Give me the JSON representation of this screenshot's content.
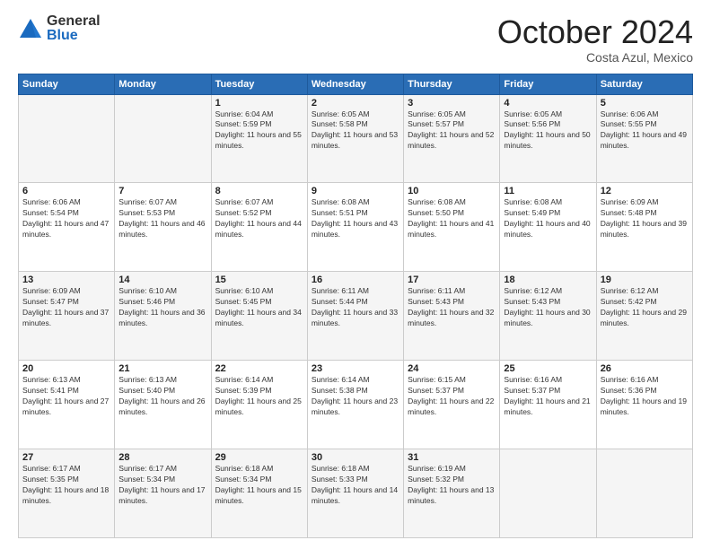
{
  "logo": {
    "general": "General",
    "blue": "Blue"
  },
  "title": {
    "month_year": "October 2024",
    "location": "Costa Azul, Mexico"
  },
  "weekdays": [
    "Sunday",
    "Monday",
    "Tuesday",
    "Wednesday",
    "Thursday",
    "Friday",
    "Saturday"
  ],
  "weeks": [
    [
      {
        "day": "",
        "info": ""
      },
      {
        "day": "",
        "info": ""
      },
      {
        "day": "1",
        "sunrise": "Sunrise: 6:04 AM",
        "sunset": "Sunset: 5:59 PM",
        "daylight": "Daylight: 11 hours and 55 minutes."
      },
      {
        "day": "2",
        "sunrise": "Sunrise: 6:05 AM",
        "sunset": "Sunset: 5:58 PM",
        "daylight": "Daylight: 11 hours and 53 minutes."
      },
      {
        "day": "3",
        "sunrise": "Sunrise: 6:05 AM",
        "sunset": "Sunset: 5:57 PM",
        "daylight": "Daylight: 11 hours and 52 minutes."
      },
      {
        "day": "4",
        "sunrise": "Sunrise: 6:05 AM",
        "sunset": "Sunset: 5:56 PM",
        "daylight": "Daylight: 11 hours and 50 minutes."
      },
      {
        "day": "5",
        "sunrise": "Sunrise: 6:06 AM",
        "sunset": "Sunset: 5:55 PM",
        "daylight": "Daylight: 11 hours and 49 minutes."
      }
    ],
    [
      {
        "day": "6",
        "sunrise": "Sunrise: 6:06 AM",
        "sunset": "Sunset: 5:54 PM",
        "daylight": "Daylight: 11 hours and 47 minutes."
      },
      {
        "day": "7",
        "sunrise": "Sunrise: 6:07 AM",
        "sunset": "Sunset: 5:53 PM",
        "daylight": "Daylight: 11 hours and 46 minutes."
      },
      {
        "day": "8",
        "sunrise": "Sunrise: 6:07 AM",
        "sunset": "Sunset: 5:52 PM",
        "daylight": "Daylight: 11 hours and 44 minutes."
      },
      {
        "day": "9",
        "sunrise": "Sunrise: 6:08 AM",
        "sunset": "Sunset: 5:51 PM",
        "daylight": "Daylight: 11 hours and 43 minutes."
      },
      {
        "day": "10",
        "sunrise": "Sunrise: 6:08 AM",
        "sunset": "Sunset: 5:50 PM",
        "daylight": "Daylight: 11 hours and 41 minutes."
      },
      {
        "day": "11",
        "sunrise": "Sunrise: 6:08 AM",
        "sunset": "Sunset: 5:49 PM",
        "daylight": "Daylight: 11 hours and 40 minutes."
      },
      {
        "day": "12",
        "sunrise": "Sunrise: 6:09 AM",
        "sunset": "Sunset: 5:48 PM",
        "daylight": "Daylight: 11 hours and 39 minutes."
      }
    ],
    [
      {
        "day": "13",
        "sunrise": "Sunrise: 6:09 AM",
        "sunset": "Sunset: 5:47 PM",
        "daylight": "Daylight: 11 hours and 37 minutes."
      },
      {
        "day": "14",
        "sunrise": "Sunrise: 6:10 AM",
        "sunset": "Sunset: 5:46 PM",
        "daylight": "Daylight: 11 hours and 36 minutes."
      },
      {
        "day": "15",
        "sunrise": "Sunrise: 6:10 AM",
        "sunset": "Sunset: 5:45 PM",
        "daylight": "Daylight: 11 hours and 34 minutes."
      },
      {
        "day": "16",
        "sunrise": "Sunrise: 6:11 AM",
        "sunset": "Sunset: 5:44 PM",
        "daylight": "Daylight: 11 hours and 33 minutes."
      },
      {
        "day": "17",
        "sunrise": "Sunrise: 6:11 AM",
        "sunset": "Sunset: 5:43 PM",
        "daylight": "Daylight: 11 hours and 32 minutes."
      },
      {
        "day": "18",
        "sunrise": "Sunrise: 6:12 AM",
        "sunset": "Sunset: 5:43 PM",
        "daylight": "Daylight: 11 hours and 30 minutes."
      },
      {
        "day": "19",
        "sunrise": "Sunrise: 6:12 AM",
        "sunset": "Sunset: 5:42 PM",
        "daylight": "Daylight: 11 hours and 29 minutes."
      }
    ],
    [
      {
        "day": "20",
        "sunrise": "Sunrise: 6:13 AM",
        "sunset": "Sunset: 5:41 PM",
        "daylight": "Daylight: 11 hours and 27 minutes."
      },
      {
        "day": "21",
        "sunrise": "Sunrise: 6:13 AM",
        "sunset": "Sunset: 5:40 PM",
        "daylight": "Daylight: 11 hours and 26 minutes."
      },
      {
        "day": "22",
        "sunrise": "Sunrise: 6:14 AM",
        "sunset": "Sunset: 5:39 PM",
        "daylight": "Daylight: 11 hours and 25 minutes."
      },
      {
        "day": "23",
        "sunrise": "Sunrise: 6:14 AM",
        "sunset": "Sunset: 5:38 PM",
        "daylight": "Daylight: 11 hours and 23 minutes."
      },
      {
        "day": "24",
        "sunrise": "Sunrise: 6:15 AM",
        "sunset": "Sunset: 5:37 PM",
        "daylight": "Daylight: 11 hours and 22 minutes."
      },
      {
        "day": "25",
        "sunrise": "Sunrise: 6:16 AM",
        "sunset": "Sunset: 5:37 PM",
        "daylight": "Daylight: 11 hours and 21 minutes."
      },
      {
        "day": "26",
        "sunrise": "Sunrise: 6:16 AM",
        "sunset": "Sunset: 5:36 PM",
        "daylight": "Daylight: 11 hours and 19 minutes."
      }
    ],
    [
      {
        "day": "27",
        "sunrise": "Sunrise: 6:17 AM",
        "sunset": "Sunset: 5:35 PM",
        "daylight": "Daylight: 11 hours and 18 minutes."
      },
      {
        "day": "28",
        "sunrise": "Sunrise: 6:17 AM",
        "sunset": "Sunset: 5:34 PM",
        "daylight": "Daylight: 11 hours and 17 minutes."
      },
      {
        "day": "29",
        "sunrise": "Sunrise: 6:18 AM",
        "sunset": "Sunset: 5:34 PM",
        "daylight": "Daylight: 11 hours and 15 minutes."
      },
      {
        "day": "30",
        "sunrise": "Sunrise: 6:18 AM",
        "sunset": "Sunset: 5:33 PM",
        "daylight": "Daylight: 11 hours and 14 minutes."
      },
      {
        "day": "31",
        "sunrise": "Sunrise: 6:19 AM",
        "sunset": "Sunset: 5:32 PM",
        "daylight": "Daylight: 11 hours and 13 minutes."
      },
      {
        "day": "",
        "info": ""
      },
      {
        "day": "",
        "info": ""
      }
    ]
  ]
}
